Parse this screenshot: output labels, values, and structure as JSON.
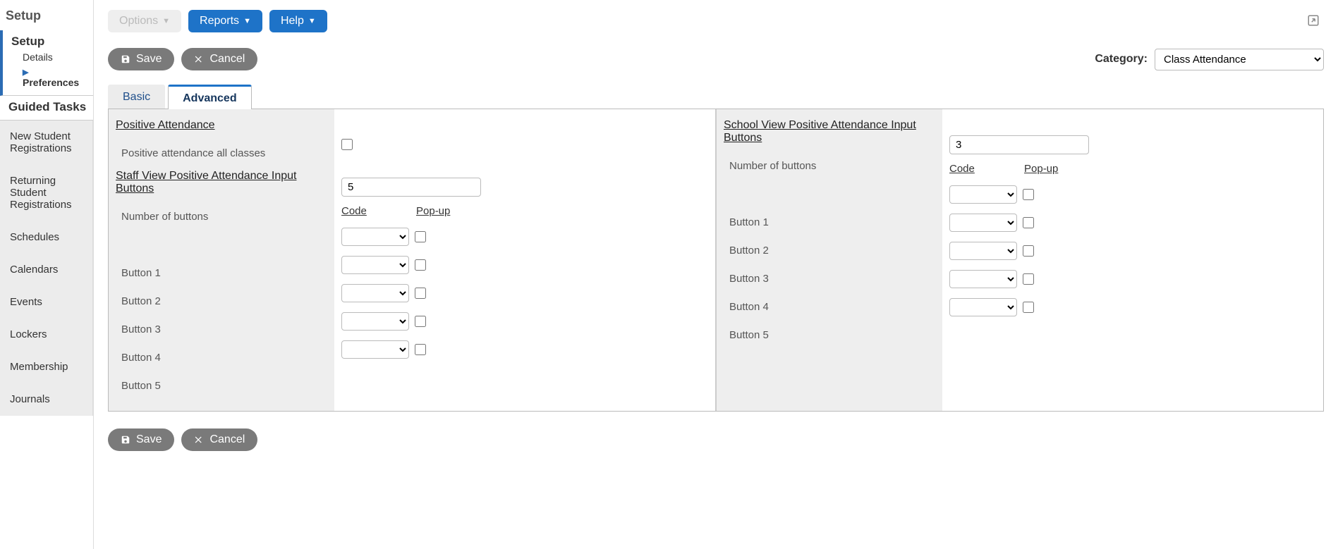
{
  "breadcrumb": "Setup",
  "side_setup": {
    "title": "Setup",
    "details": "Details",
    "preferences": "Preferences"
  },
  "side_guided": {
    "title": "Guided Tasks"
  },
  "side_items": [
    "New Student Registrations",
    "Returning Student Registrations",
    "Schedules",
    "Calendars",
    "Events",
    "Lockers",
    "Membership",
    "Journals"
  ],
  "toolbar": {
    "options": "Options",
    "reports": "Reports",
    "help": "Help"
  },
  "actions": {
    "save": "Save",
    "cancel": "Cancel"
  },
  "category": {
    "label": "Category:",
    "value": "Class Attendance"
  },
  "tabs": {
    "basic": "Basic",
    "advanced": "Advanced",
    "active": "advanced"
  },
  "content": {
    "pos_att_header": "Positive Attendance",
    "pos_att_all_label": "Positive attendance all classes",
    "pos_att_all_checked": false,
    "staff_header": "Staff View Positive Attendance Input Buttons",
    "staff_nob_label": "Number of buttons",
    "staff_nob_value": "5",
    "school_header": "School View Positive Attendance Input Buttons",
    "school_nob_label": "Number of buttons",
    "school_nob_value": "3",
    "code_label": "Code",
    "popup_label": "Pop-up",
    "button_labels": [
      "Button 1",
      "Button 2",
      "Button 3",
      "Button 4",
      "Button 5"
    ]
  }
}
